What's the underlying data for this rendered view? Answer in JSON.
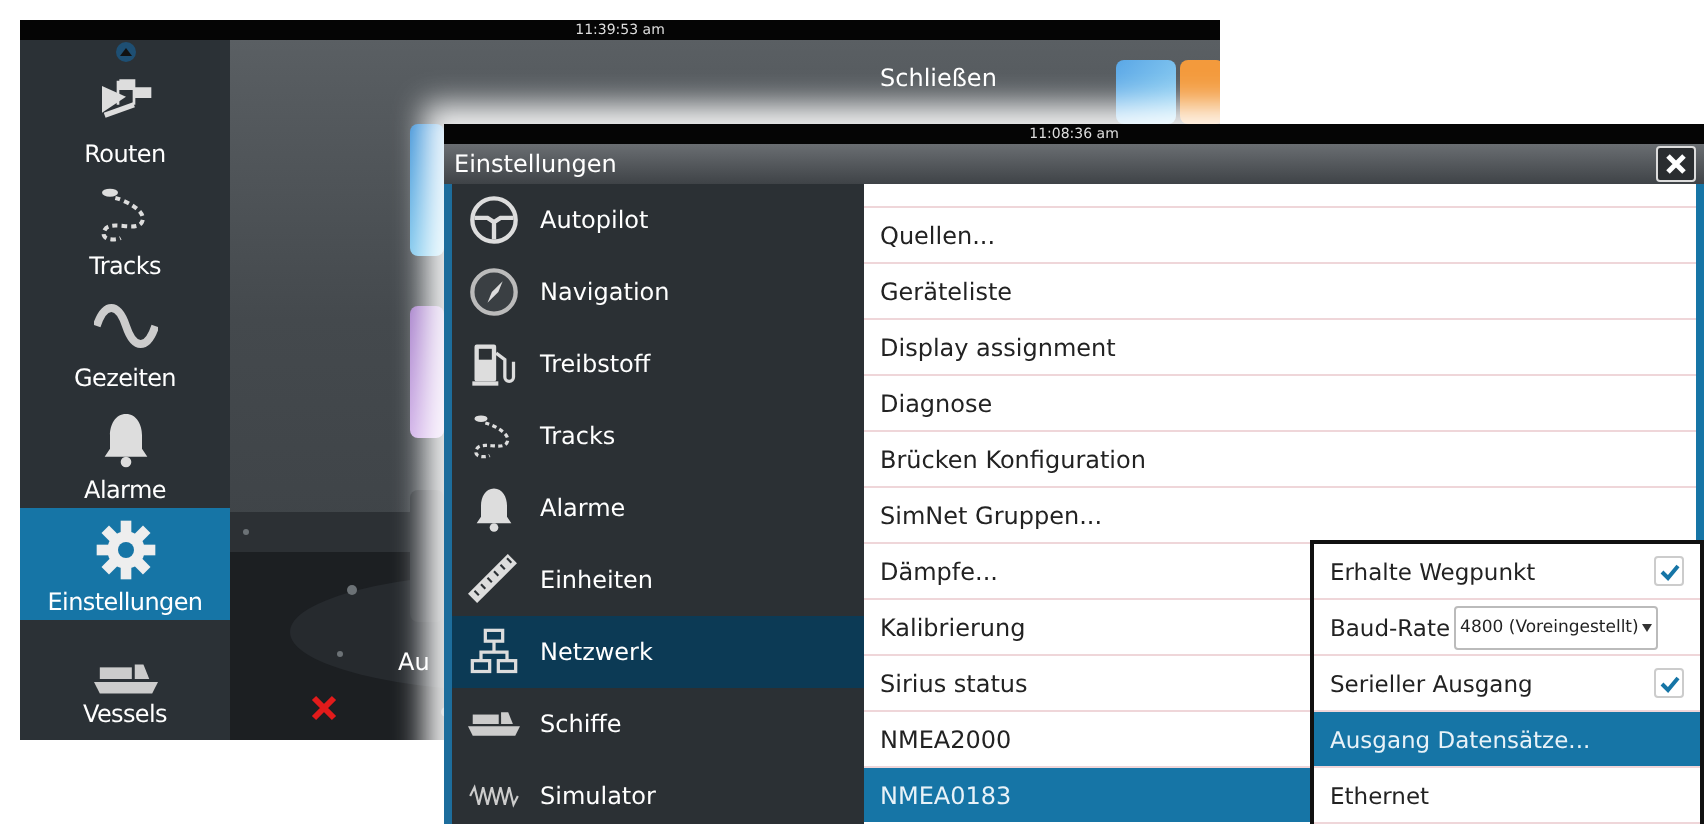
{
  "background_screen": {
    "clock": "11:39:53 am",
    "close_label": "Schließen",
    "partial_tile_label": "Au",
    "sidebar": [
      {
        "label": "Routen",
        "selected": false
      },
      {
        "label": "Tracks",
        "selected": false
      },
      {
        "label": "Gezeiten",
        "selected": false
      },
      {
        "label": "Alarme",
        "selected": false
      },
      {
        "label": "Einstellungen",
        "selected": true
      },
      {
        "label": "Vessels",
        "selected": false
      }
    ]
  },
  "settings_window": {
    "clock": "11:08:36 am",
    "title": "Einstellungen",
    "menu": [
      {
        "label": "Autopilot",
        "selected": false
      },
      {
        "label": "Navigation",
        "selected": false
      },
      {
        "label": "Treibstoff",
        "selected": false
      },
      {
        "label": "Tracks",
        "selected": false
      },
      {
        "label": "Alarme",
        "selected": false
      },
      {
        "label": "Einheiten",
        "selected": false
      },
      {
        "label": "Netzwerk",
        "selected": true
      },
      {
        "label": "Schiffe",
        "selected": false
      },
      {
        "label": "Simulator",
        "selected": false
      }
    ],
    "options": [
      {
        "label": "Quellen...",
        "selected": false
      },
      {
        "label": "Geräteliste",
        "selected": false
      },
      {
        "label": "Display assignment",
        "selected": false
      },
      {
        "label": "Diagnose",
        "selected": false
      },
      {
        "label": "Brücken Konfiguration",
        "selected": false
      },
      {
        "label": "SimNet Gruppen...",
        "selected": false
      },
      {
        "label": "Dämpfe...",
        "selected": false
      },
      {
        "label": "Kalibrierung",
        "selected": false
      },
      {
        "label": "Sirius status",
        "selected": false
      },
      {
        "label": "NMEA2000",
        "selected": false
      },
      {
        "label": "NMEA0183",
        "selected": true
      }
    ]
  },
  "nmea0183_popup": {
    "rows": [
      {
        "kind": "checkbox",
        "label": "Erhalte Wegpunkt",
        "checked": true,
        "selected": false
      },
      {
        "kind": "dropdown",
        "label": "Baud-Rate",
        "value": "4800 (Voreingestellt)",
        "selected": false
      },
      {
        "kind": "checkbox",
        "label": "Serieller Ausgang",
        "checked": true,
        "selected": false
      },
      {
        "kind": "action",
        "label": "Ausgang Datensätze...",
        "selected": true
      },
      {
        "kind": "action",
        "label": "Ethernet",
        "selected": false
      }
    ]
  }
}
